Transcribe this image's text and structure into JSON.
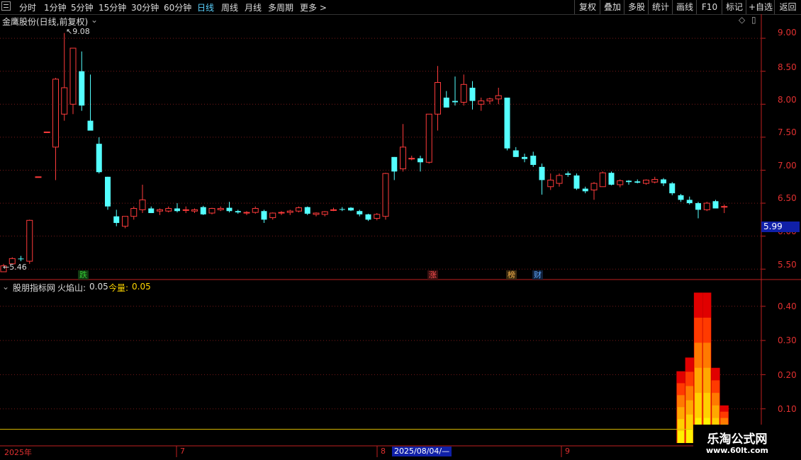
{
  "toolbar": {
    "left_items": [
      "分时",
      "1分钟",
      "5分钟",
      "15分钟",
      "30分钟",
      "60分钟",
      "日线",
      "周线",
      "月线",
      "多周期",
      "更多 >"
    ],
    "active_item": "日线",
    "right_items": [
      "复权",
      "叠加",
      "多股",
      "统计",
      "画线",
      "F10",
      "标记",
      "+自选",
      "返回"
    ]
  },
  "main_chart": {
    "title": "金鹰股份(日线,前复权)",
    "y_ticks": [
      "9.00",
      "8.50",
      "8.00",
      "7.50",
      "7.00",
      "6.50",
      "6.00",
      "5.50"
    ],
    "current_price_box": "5.99",
    "high_label": "9.08",
    "low_label": "5.46",
    "event_tags": [
      "跌",
      "涨",
      "榜",
      "财"
    ]
  },
  "indicator": {
    "name": "股朋指标网",
    "line1_label": "火焰山:",
    "line1_value": "0.05",
    "line2_label": "今量:",
    "line2_value": "0.05",
    "y_ticks": [
      "0.40",
      "0.30",
      "0.20",
      "0.10"
    ]
  },
  "x_axis": {
    "labels": [
      "2025年",
      "7",
      "8",
      "9"
    ],
    "cursor_date": "2025/08/04/—"
  },
  "watermark": {
    "title": "乐淘公式网",
    "url": "www.60lt.com"
  },
  "colors": {
    "up": "#ff3b3b",
    "down": "#54ffff",
    "axis": "#c02020",
    "grid": "#7a1a1a"
  },
  "chart_data": {
    "type": "candlestick",
    "ohlc": [
      [
        5.46,
        5.58,
        5.46,
        5.55
      ],
      [
        5.58,
        5.68,
        5.57,
        5.66
      ],
      [
        5.66,
        5.7,
        5.62,
        5.65
      ],
      [
        5.62,
        6.25,
        5.58,
        6.24
      ],
      [
        6.9,
        6.9,
        6.9,
        6.9
      ],
      [
        7.58,
        7.58,
        7.58,
        7.58
      ],
      [
        7.35,
        8.4,
        6.85,
        8.38
      ],
      [
        7.85,
        9.08,
        7.75,
        8.25
      ],
      [
        8.0,
        8.75,
        7.85,
        8.85
      ],
      [
        8.5,
        8.8,
        7.9,
        7.98
      ],
      [
        7.75,
        8.45,
        7.6,
        7.6
      ],
      [
        7.4,
        7.5,
        6.95,
        6.97
      ],
      [
        6.9,
        6.9,
        6.4,
        6.45
      ],
      [
        6.3,
        6.4,
        6.15,
        6.2
      ],
      [
        6.15,
        6.3,
        6.12,
        6.3
      ],
      [
        6.3,
        6.45,
        6.25,
        6.42
      ],
      [
        6.4,
        6.78,
        6.35,
        6.55
      ],
      [
        6.42,
        6.45,
        6.35,
        6.35
      ],
      [
        6.38,
        6.42,
        6.32,
        6.4
      ],
      [
        6.38,
        6.45,
        6.36,
        6.42
      ],
      [
        6.42,
        6.5,
        6.36,
        6.38
      ],
      [
        6.4,
        6.45,
        6.35,
        6.4
      ],
      [
        6.38,
        6.42,
        6.35,
        6.4
      ],
      [
        6.44,
        6.46,
        6.32,
        6.33
      ],
      [
        6.35,
        6.43,
        6.33,
        6.42
      ],
      [
        6.4,
        6.45,
        6.38,
        6.42
      ],
      [
        6.43,
        6.52,
        6.36,
        6.38
      ],
      [
        6.38,
        6.4,
        6.34,
        6.36
      ],
      [
        6.35,
        6.38,
        6.32,
        6.36
      ],
      [
        6.36,
        6.45,
        6.34,
        6.42
      ],
      [
        6.38,
        6.4,
        6.2,
        6.25
      ],
      [
        6.28,
        6.36,
        6.25,
        6.35
      ],
      [
        6.36,
        6.38,
        6.32,
        6.36
      ],
      [
        6.36,
        6.4,
        6.32,
        6.38
      ],
      [
        6.38,
        6.45,
        6.36,
        6.43
      ],
      [
        6.44,
        6.45,
        6.32,
        6.34
      ],
      [
        6.33,
        6.36,
        6.3,
        6.35
      ],
      [
        6.33,
        6.38,
        6.3,
        6.37
      ],
      [
        6.4,
        6.43,
        6.38,
        6.4
      ],
      [
        6.41,
        6.44,
        6.38,
        6.4
      ],
      [
        6.43,
        6.44,
        6.38,
        6.39
      ],
      [
        6.38,
        6.4,
        6.3,
        6.33
      ],
      [
        6.33,
        6.34,
        6.23,
        6.25
      ],
      [
        6.27,
        6.35,
        6.24,
        6.33
      ],
      [
        6.3,
        6.96,
        6.25,
        6.95
      ],
      [
        7.2,
        7.2,
        6.85,
        6.98
      ],
      [
        7.02,
        7.7,
        6.98,
        7.35
      ],
      [
        7.18,
        7.22,
        7.15,
        7.18
      ],
      [
        7.18,
        7.22,
        6.98,
        7.12
      ],
      [
        7.12,
        7.85,
        7.1,
        7.85
      ],
      [
        7.85,
        8.58,
        7.6,
        8.33
      ],
      [
        8.1,
        8.2,
        7.95,
        7.95
      ],
      [
        8.05,
        8.42,
        7.98,
        8.03
      ],
      [
        8.03,
        8.45,
        7.98,
        8.3
      ],
      [
        8.25,
        8.35,
        7.92,
        8.05
      ],
      [
        8.0,
        8.1,
        7.9,
        8.05
      ],
      [
        8.05,
        8.1,
        8.0,
        8.08
      ],
      [
        8.08,
        8.25,
        8.0,
        8.13
      ],
      [
        8.1,
        8.1,
        7.3,
        7.33
      ],
      [
        7.3,
        7.35,
        7.2,
        7.2
      ],
      [
        7.2,
        7.25,
        7.12,
        7.17
      ],
      [
        7.22,
        7.28,
        7.05,
        7.08
      ],
      [
        7.05,
        7.1,
        6.63,
        6.85
      ],
      [
        6.75,
        6.95,
        6.7,
        6.85
      ],
      [
        6.8,
        6.95,
        6.75,
        6.92
      ],
      [
        6.95,
        6.98,
        6.9,
        6.93
      ],
      [
        6.92,
        6.95,
        6.7,
        6.72
      ],
      [
        6.72,
        6.75,
        6.65,
        6.68
      ],
      [
        6.7,
        6.82,
        6.55,
        6.8
      ],
      [
        6.75,
        6.98,
        6.75,
        6.96
      ],
      [
        6.96,
        6.98,
        6.77,
        6.78
      ],
      [
        6.78,
        6.86,
        6.74,
        6.84
      ],
      [
        6.84,
        6.85,
        6.78,
        6.82
      ],
      [
        6.83,
        6.86,
        6.8,
        6.81
      ],
      [
        6.8,
        6.86,
        6.78,
        6.85
      ],
      [
        6.82,
        6.9,
        6.8,
        6.86
      ],
      [
        6.86,
        6.88,
        6.76,
        6.8
      ],
      [
        6.8,
        6.82,
        6.62,
        6.65
      ],
      [
        6.62,
        6.64,
        6.52,
        6.55
      ],
      [
        6.55,
        6.6,
        6.48,
        6.5
      ],
      [
        6.5,
        6.52,
        6.27,
        6.4
      ],
      [
        6.4,
        6.52,
        6.38,
        6.5
      ],
      [
        6.53,
        6.55,
        6.42,
        6.42
      ],
      [
        6.45,
        6.48,
        6.35,
        6.45
      ]
    ],
    "indicator": {
      "name": "火焰山",
      "bars": [
        {
          "index": 78,
          "value": 0.21
        },
        {
          "index": 79,
          "value": 0.25
        },
        {
          "index": 80,
          "value": 0.44
        },
        {
          "index": 81,
          "value": 0.44
        },
        {
          "index": 82,
          "value": 0.22
        },
        {
          "index": 83,
          "value": 0.11
        }
      ]
    }
  }
}
